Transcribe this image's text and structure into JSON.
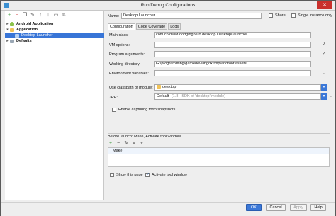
{
  "window": {
    "title": "Run/Debug Configurations",
    "controls": {
      "minimize": "—",
      "maximize": "☐",
      "close": "✕"
    }
  },
  "left_toolbar": {
    "icons": [
      "add-icon",
      "remove-icon",
      "copy-icon",
      "settings-icon",
      "move-up-icon",
      "move-down-icon",
      "folder-icon",
      "sort-icon"
    ],
    "glyphs": [
      "+",
      "−",
      "❐",
      "✎",
      "↑",
      "↓",
      "▭",
      "⇅"
    ]
  },
  "tree": {
    "android_application": "Android Application",
    "application": "Application",
    "desktop_launcher": "Desktop Launcher",
    "defaults": "Defaults"
  },
  "header": {
    "name_label": "Name:",
    "name_value": "Desktop Launcher",
    "share_label": "Share",
    "single_instance_label": "Single instance only"
  },
  "tabs": [
    "Configuration",
    "Code Coverage",
    "Logs"
  ],
  "config": {
    "main_class_label": "Main class:",
    "main_class_value": "com.coldwild.dodginghero.desktop.DesktopLauncher",
    "vm_options_label": "VM options:",
    "vm_options_value": "",
    "program_args_label": "Program arguments:",
    "program_args_value": "",
    "working_dir_label": "Working directory:",
    "working_dir_value": "G:\\programming\\gamedev\\libgdx\\tmp\\android\\assets",
    "env_vars_label": "Environment variables:",
    "env_vars_value": "",
    "classpath_label": "Use classpath of module:",
    "classpath_value": "desktop",
    "jre_label": "JRE:",
    "jre_value": "Default",
    "jre_hint": "(1.8 - SDK of 'desktop' module)",
    "capture_label": "Enable capturing form snapshots",
    "dots": "...",
    "expand": "↗",
    "combo_arrow": "▼"
  },
  "before_launch": {
    "title": "Before launch: Make, Activate tool window",
    "items": [
      "Make"
    ],
    "toolbar_glyphs": [
      "+",
      "−",
      "✎",
      "▲",
      "▼"
    ],
    "show_page_label": "Show this page",
    "activate_tool_label": "Activate tool window",
    "show_page_checked": false,
    "activate_tool_checked": true
  },
  "buttons": {
    "ok": "OK",
    "cancel": "Cancel",
    "apply": "Apply",
    "help": "Help"
  },
  "colors": {
    "selection": "#3875d7",
    "accent": "#3b78d8",
    "close_red": "#c9302c"
  }
}
